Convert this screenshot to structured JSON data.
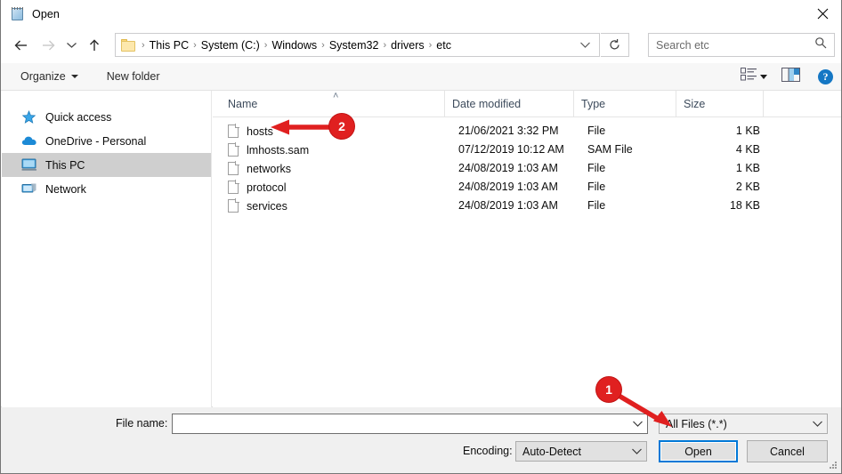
{
  "window": {
    "title": "Open",
    "title_icon": "notepad-icon",
    "close_label": "✕"
  },
  "nav": {
    "back_icon": "arrow-left-icon",
    "forward_icon": "arrow-right-icon",
    "recent_icon": "chevron-down-icon",
    "up_icon": "arrow-up-icon",
    "breadcrumbs": [
      "This PC",
      "System (C:)",
      "Windows",
      "System32",
      "drivers",
      "etc"
    ],
    "separator": "›",
    "address_chevron": "chevron-down-icon",
    "refresh_icon": "refresh-icon"
  },
  "search": {
    "placeholder": "Search etc",
    "value": "",
    "icon": "search-icon"
  },
  "toolbar": {
    "organize_label": "Organize",
    "new_folder_label": "New folder",
    "view_icon": "view-list-icon",
    "view_caret_icon": "caret-down-icon",
    "preview_pane_icon": "preview-pane-icon",
    "help_icon": "help-icon",
    "help_glyph": "?"
  },
  "sidebar": {
    "items": [
      {
        "label": "Quick access",
        "icon": "star-icon",
        "selected": false
      },
      {
        "label": "OneDrive - Personal",
        "icon": "cloud-icon",
        "selected": false
      },
      {
        "label": "This PC",
        "icon": "monitor-icon",
        "selected": true
      },
      {
        "label": "Network",
        "icon": "network-icon",
        "selected": false
      }
    ]
  },
  "filelist": {
    "columns": [
      "Name",
      "Date modified",
      "Type",
      "Size"
    ],
    "sort_column": "Name",
    "sort_indicator": "˄",
    "rows": [
      {
        "name": "hosts",
        "date": "21/06/2021 3:32 PM",
        "type": "File",
        "size": "1 KB",
        "icon": "document-icon"
      },
      {
        "name": "lmhosts.sam",
        "date": "07/12/2019 10:12 AM",
        "type": "SAM File",
        "size": "4 KB",
        "icon": "document-icon"
      },
      {
        "name": "networks",
        "date": "24/08/2019 1:03 AM",
        "type": "File",
        "size": "1 KB",
        "icon": "document-icon"
      },
      {
        "name": "protocol",
        "date": "24/08/2019 1:03 AM",
        "type": "File",
        "size": "2 KB",
        "icon": "document-icon"
      },
      {
        "name": "services",
        "date": "24/08/2019 1:03 AM",
        "type": "File",
        "size": "18 KB",
        "icon": "document-icon"
      }
    ]
  },
  "footer": {
    "filename_label": "File name:",
    "filename_value": "",
    "filename_caret_icon": "chevron-down-icon",
    "filter_value": "All Files  (*.*)",
    "filter_caret_icon": "chevron-down-icon",
    "encoding_label": "Encoding:",
    "encoding_value": "Auto-Detect",
    "encoding_caret_icon": "chevron-down-icon",
    "open_label": "Open",
    "cancel_label": "Cancel",
    "resize_grip_icon": "resize-grip-icon"
  },
  "annotations": [
    {
      "label": "1",
      "color": "#e02020",
      "target": "file-type-filter-dropdown"
    },
    {
      "label": "2",
      "color": "#e02020",
      "target": "file-row-hosts"
    }
  ],
  "colors": {
    "accent": "#0078d7",
    "annotation": "#e02020",
    "selection": "#cfcfcf",
    "help_blue": "#1577c4"
  }
}
